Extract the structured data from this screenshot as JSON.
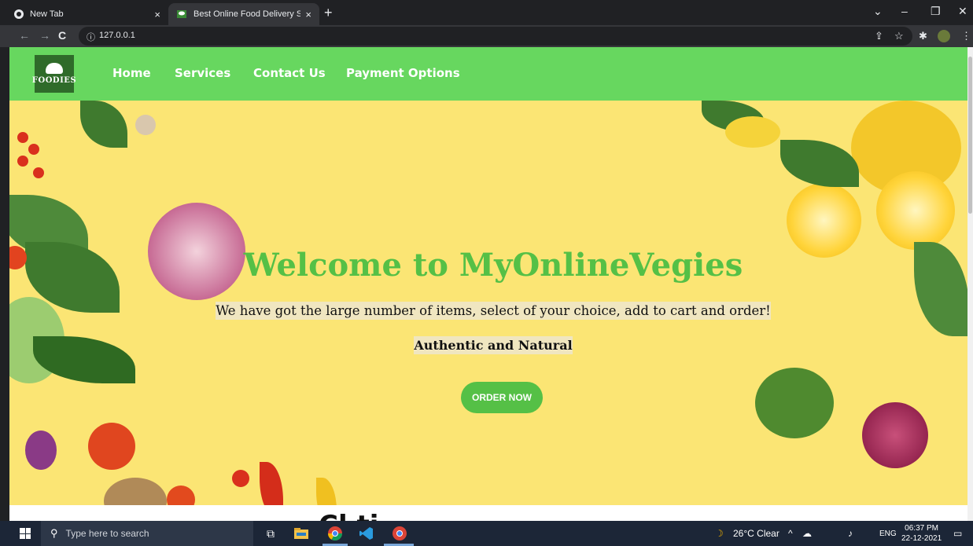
{
  "browser": {
    "tabs": [
      {
        "title": "New Tab",
        "close": "×"
      },
      {
        "title": "Best Online Food Delivery Servic",
        "close": "×"
      }
    ],
    "new_tab": "+",
    "window_controls": {
      "minimize": "–",
      "restore": "❐",
      "close": "✕",
      "tab_search": "⌄"
    },
    "url": "127.0.0.1",
    "nav": {
      "back": "←",
      "forward": "→",
      "reload": "C",
      "info": "ⓘ"
    },
    "toolbar": {
      "share": "⇪",
      "bookmark": "☆",
      "extensions": "✱",
      "menu": "⋮"
    }
  },
  "site": {
    "logo_text": "FOODIES",
    "menu": [
      "Home",
      "Services",
      "Contact Us",
      "Payment Options"
    ],
    "hero": {
      "heading": "Welcome to MyOnlineVegies",
      "tagline": "We have got the large number of items, select of your choice, add to cart and order!",
      "subtitle": "Authentic and Natural",
      "cta": "ORDER NOW"
    },
    "next_section_peek": "Cl              ti"
  },
  "taskbar": {
    "search_placeholder": "Type here to search",
    "weather": "26°C  Clear",
    "language": "ENG",
    "time": "06:37 PM",
    "date": "22-12-2021"
  },
  "colors": {
    "nav_green": "#67d75f",
    "hero_yellow": "#fbe574",
    "accent_green": "#55c046"
  }
}
